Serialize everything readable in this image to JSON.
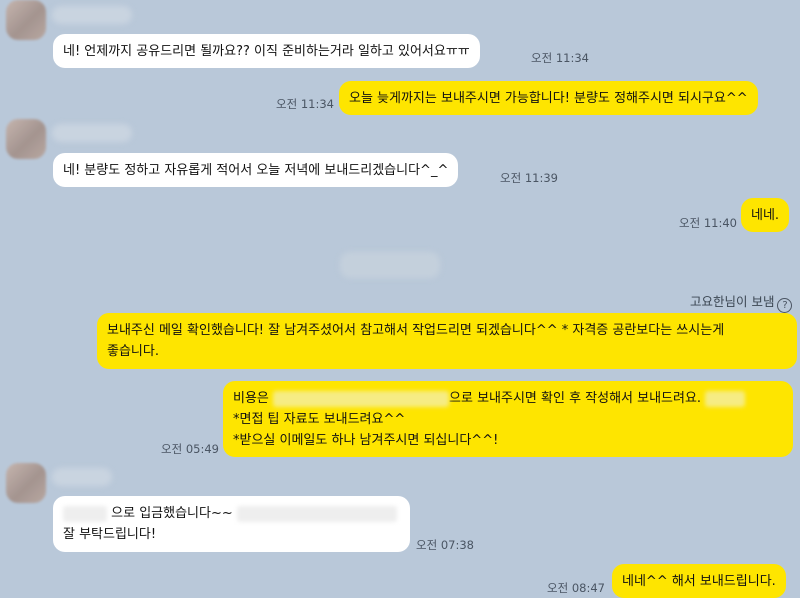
{
  "messages": [
    {
      "side": "left",
      "text": "네! 언제까지 공유드리면 될까요?? 이직 준비하는거라 일하고 있어서요ㅠㅠ",
      "time": "오전 11:34"
    },
    {
      "side": "right",
      "text": "오늘 늦게까지는 보내주시면 가능합니다! 분량도 정해주시면 되시구요^^",
      "time": "오전 11:34"
    },
    {
      "side": "left",
      "text": "네! 분량도 정하고 자유롭게 적어서 오늘 저녁에 보내드리겠습니다^_^",
      "time": "오전 11:39"
    },
    {
      "side": "right",
      "text": "네네.",
      "time": "오전 11:40"
    },
    {
      "side": "right",
      "line1": "보내주신 메일 확인했습니다! 잘 남겨주셨어서 참고해서 작업드리면 되겠습니다^^ * 자격증 공란보다는 쓰시는게",
      "line2": "좋습니다."
    },
    {
      "side": "right",
      "line1_prefix": "비용은",
      "line1_suffix": "으로 보내주시면 확인 후 작성해서 보내드려요.",
      "line2": "*면접 팁 자료도 보내드려요^^",
      "line3": "*받으실 이메일도 하나 남겨주시면 되십니다^^!",
      "time": "오전 05:49"
    },
    {
      "side": "left",
      "line1": "으로 입금했습니다~~",
      "line2": "잘 부탁드립니다!",
      "time": "오전 07:38"
    },
    {
      "side": "right",
      "text": "네네^^ 해서 보내드립니다.",
      "time": "오전 08:47"
    }
  ],
  "sender_note": "고요한님이 보냄",
  "icons": {
    "help": "question-circle-icon"
  },
  "colors": {
    "background": "#b9c8d9",
    "my_bubble": "#fee500",
    "their_bubble": "#ffffff"
  }
}
